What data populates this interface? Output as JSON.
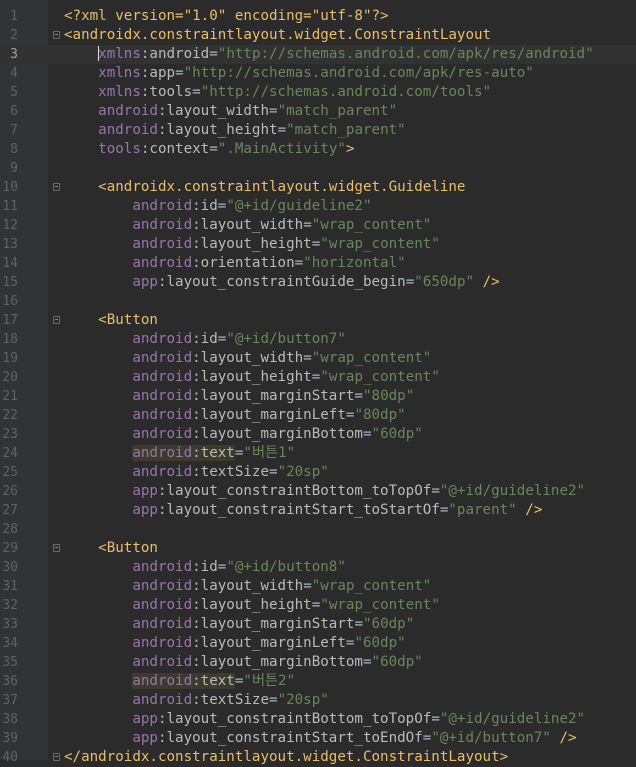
{
  "editor": {
    "language": "xml",
    "current_line": 3,
    "lines": [
      {
        "n": "1",
        "indent": "",
        "parts": [
          [
            "pi",
            "<?xml version=\"1.0\" encoding=\"utf-8\"?>"
          ]
        ]
      },
      {
        "n": "2",
        "indent": "",
        "fold": true,
        "parts": [
          [
            "brace",
            "<androidx.constraintlayout.widget.ConstraintLayout"
          ]
        ]
      },
      {
        "n": "3",
        "indent": "    ",
        "caret": true,
        "parts": [
          [
            "ns",
            "xmlns"
          ],
          [
            "attr",
            ":android"
          ],
          [
            "eq",
            "="
          ],
          [
            "val",
            "\"http://schemas.android.com/apk/res/android\""
          ]
        ]
      },
      {
        "n": "4",
        "indent": "    ",
        "parts": [
          [
            "ns",
            "xmlns"
          ],
          [
            "attr",
            ":app"
          ],
          [
            "eq",
            "="
          ],
          [
            "val",
            "\"http://schemas.android.com/apk/res-auto\""
          ]
        ]
      },
      {
        "n": "5",
        "indent": "    ",
        "parts": [
          [
            "ns",
            "xmlns"
          ],
          [
            "attr",
            ":tools"
          ],
          [
            "eq",
            "="
          ],
          [
            "val",
            "\"http://schemas.android.com/tools\""
          ]
        ]
      },
      {
        "n": "6",
        "indent": "    ",
        "parts": [
          [
            "ns",
            "android"
          ],
          [
            "attr",
            ":layout_width"
          ],
          [
            "eq",
            "="
          ],
          [
            "val",
            "\"match_parent\""
          ]
        ]
      },
      {
        "n": "7",
        "indent": "    ",
        "parts": [
          [
            "ns",
            "android"
          ],
          [
            "attr",
            ":layout_height"
          ],
          [
            "eq",
            "="
          ],
          [
            "val",
            "\"match_parent\""
          ]
        ]
      },
      {
        "n": "8",
        "indent": "    ",
        "parts": [
          [
            "ns",
            "tools"
          ],
          [
            "attr",
            ":context"
          ],
          [
            "eq",
            "="
          ],
          [
            "val",
            "\".MainActivity\""
          ],
          [
            "brace",
            ">"
          ]
        ]
      },
      {
        "n": "9",
        "indent": "",
        "parts": []
      },
      {
        "n": "10",
        "indent": "    ",
        "fold": true,
        "parts": [
          [
            "brace",
            "<androidx.constraintlayout.widget.Guideline"
          ]
        ]
      },
      {
        "n": "11",
        "indent": "        ",
        "parts": [
          [
            "ns",
            "android"
          ],
          [
            "attr",
            ":id"
          ],
          [
            "eq",
            "="
          ],
          [
            "val",
            "\"@+id/guideline2\""
          ]
        ]
      },
      {
        "n": "12",
        "indent": "        ",
        "parts": [
          [
            "ns",
            "android"
          ],
          [
            "attr",
            ":layout_width"
          ],
          [
            "eq",
            "="
          ],
          [
            "val",
            "\"wrap_content\""
          ]
        ]
      },
      {
        "n": "13",
        "indent": "        ",
        "parts": [
          [
            "ns",
            "android"
          ],
          [
            "attr",
            ":layout_height"
          ],
          [
            "eq",
            "="
          ],
          [
            "val",
            "\"wrap_content\""
          ]
        ]
      },
      {
        "n": "14",
        "indent": "        ",
        "parts": [
          [
            "ns",
            "android"
          ],
          [
            "attr",
            ":orientation"
          ],
          [
            "eq",
            "="
          ],
          [
            "val",
            "\"horizontal\""
          ]
        ]
      },
      {
        "n": "15",
        "indent": "        ",
        "parts": [
          [
            "ns",
            "app"
          ],
          [
            "attr",
            ":layout_constraintGuide_begin"
          ],
          [
            "eq",
            "="
          ],
          [
            "val",
            "\"650dp\""
          ],
          [
            "brace",
            " />"
          ]
        ]
      },
      {
        "n": "16",
        "indent": "",
        "parts": []
      },
      {
        "n": "17",
        "indent": "    ",
        "fold": true,
        "parts": [
          [
            "brace",
            "<Button"
          ]
        ]
      },
      {
        "n": "18",
        "indent": "        ",
        "parts": [
          [
            "ns",
            "android"
          ],
          [
            "attr",
            ":id"
          ],
          [
            "eq",
            "="
          ],
          [
            "val",
            "\"@+id/button7\""
          ]
        ]
      },
      {
        "n": "19",
        "indent": "        ",
        "parts": [
          [
            "ns",
            "android"
          ],
          [
            "attr",
            ":layout_width"
          ],
          [
            "eq",
            "="
          ],
          [
            "val",
            "\"wrap_content\""
          ]
        ]
      },
      {
        "n": "20",
        "indent": "        ",
        "parts": [
          [
            "ns",
            "android"
          ],
          [
            "attr",
            ":layout_height"
          ],
          [
            "eq",
            "="
          ],
          [
            "val",
            "\"wrap_content\""
          ]
        ]
      },
      {
        "n": "21",
        "indent": "        ",
        "parts": [
          [
            "ns",
            "android"
          ],
          [
            "attr",
            ":layout_marginStart"
          ],
          [
            "eq",
            "="
          ],
          [
            "val",
            "\"80dp\""
          ]
        ]
      },
      {
        "n": "22",
        "indent": "        ",
        "parts": [
          [
            "ns",
            "android"
          ],
          [
            "attr",
            ":layout_marginLeft"
          ],
          [
            "eq",
            "="
          ],
          [
            "val",
            "\"80dp\""
          ]
        ]
      },
      {
        "n": "23",
        "indent": "        ",
        "parts": [
          [
            "ns",
            "android"
          ],
          [
            "attr",
            ":layout_marginBottom"
          ],
          [
            "eq",
            "="
          ],
          [
            "val",
            "\"60dp\""
          ]
        ]
      },
      {
        "n": "24",
        "indent": "        ",
        "highlight": true,
        "parts": [
          [
            "ns",
            "android"
          ],
          [
            "attr",
            ":text"
          ],
          [
            "eq",
            "="
          ],
          [
            "val",
            "\"버튼1\""
          ]
        ]
      },
      {
        "n": "25",
        "indent": "        ",
        "parts": [
          [
            "ns",
            "android"
          ],
          [
            "attr",
            ":textSize"
          ],
          [
            "eq",
            "="
          ],
          [
            "val",
            "\"20sp\""
          ]
        ]
      },
      {
        "n": "26",
        "indent": "        ",
        "parts": [
          [
            "ns",
            "app"
          ],
          [
            "attr",
            ":layout_constraintBottom_toTopOf"
          ],
          [
            "eq",
            "="
          ],
          [
            "val",
            "\"@+id/guideline2\""
          ]
        ]
      },
      {
        "n": "27",
        "indent": "        ",
        "parts": [
          [
            "ns",
            "app"
          ],
          [
            "attr",
            ":layout_constraintStart_toStartOf"
          ],
          [
            "eq",
            "="
          ],
          [
            "val",
            "\"parent\""
          ],
          [
            "brace",
            " />"
          ]
        ]
      },
      {
        "n": "28",
        "indent": "",
        "parts": []
      },
      {
        "n": "29",
        "indent": "    ",
        "fold": true,
        "parts": [
          [
            "brace",
            "<Button"
          ]
        ]
      },
      {
        "n": "30",
        "indent": "        ",
        "parts": [
          [
            "ns",
            "android"
          ],
          [
            "attr",
            ":id"
          ],
          [
            "eq",
            "="
          ],
          [
            "val",
            "\"@+id/button8\""
          ]
        ]
      },
      {
        "n": "31",
        "indent": "        ",
        "parts": [
          [
            "ns",
            "android"
          ],
          [
            "attr",
            ":layout_width"
          ],
          [
            "eq",
            "="
          ],
          [
            "val",
            "\"wrap_content\""
          ]
        ]
      },
      {
        "n": "32",
        "indent": "        ",
        "parts": [
          [
            "ns",
            "android"
          ],
          [
            "attr",
            ":layout_height"
          ],
          [
            "eq",
            "="
          ],
          [
            "val",
            "\"wrap_content\""
          ]
        ]
      },
      {
        "n": "33",
        "indent": "        ",
        "parts": [
          [
            "ns",
            "android"
          ],
          [
            "attr",
            ":layout_marginStart"
          ],
          [
            "eq",
            "="
          ],
          [
            "val",
            "\"60dp\""
          ]
        ]
      },
      {
        "n": "34",
        "indent": "        ",
        "parts": [
          [
            "ns",
            "android"
          ],
          [
            "attr",
            ":layout_marginLeft"
          ],
          [
            "eq",
            "="
          ],
          [
            "val",
            "\"60dp\""
          ]
        ]
      },
      {
        "n": "35",
        "indent": "        ",
        "parts": [
          [
            "ns",
            "android"
          ],
          [
            "attr",
            ":layout_marginBottom"
          ],
          [
            "eq",
            "="
          ],
          [
            "val",
            "\"60dp\""
          ]
        ]
      },
      {
        "n": "36",
        "indent": "        ",
        "highlight": true,
        "parts": [
          [
            "ns",
            "android"
          ],
          [
            "attr",
            ":text"
          ],
          [
            "eq",
            "="
          ],
          [
            "val",
            "\"버튼2\""
          ]
        ]
      },
      {
        "n": "37",
        "indent": "        ",
        "parts": [
          [
            "ns",
            "android"
          ],
          [
            "attr",
            ":textSize"
          ],
          [
            "eq",
            "="
          ],
          [
            "val",
            "\"20sp\""
          ]
        ]
      },
      {
        "n": "38",
        "indent": "        ",
        "parts": [
          [
            "ns",
            "app"
          ],
          [
            "attr",
            ":layout_constraintBottom_toTopOf"
          ],
          [
            "eq",
            "="
          ],
          [
            "val",
            "\"@+id/guideline2\""
          ]
        ]
      },
      {
        "n": "39",
        "indent": "        ",
        "parts": [
          [
            "ns",
            "app"
          ],
          [
            "attr",
            ":layout_constraintStart_toEndOf"
          ],
          [
            "eq",
            "="
          ],
          [
            "val",
            "\"@+id/button7\""
          ],
          [
            "brace",
            " />"
          ]
        ]
      },
      {
        "n": "40",
        "indent": "",
        "fold": true,
        "parts": [
          [
            "brace",
            "</androidx.constraintlayout.widget.ConstraintLayout>"
          ]
        ]
      }
    ]
  }
}
